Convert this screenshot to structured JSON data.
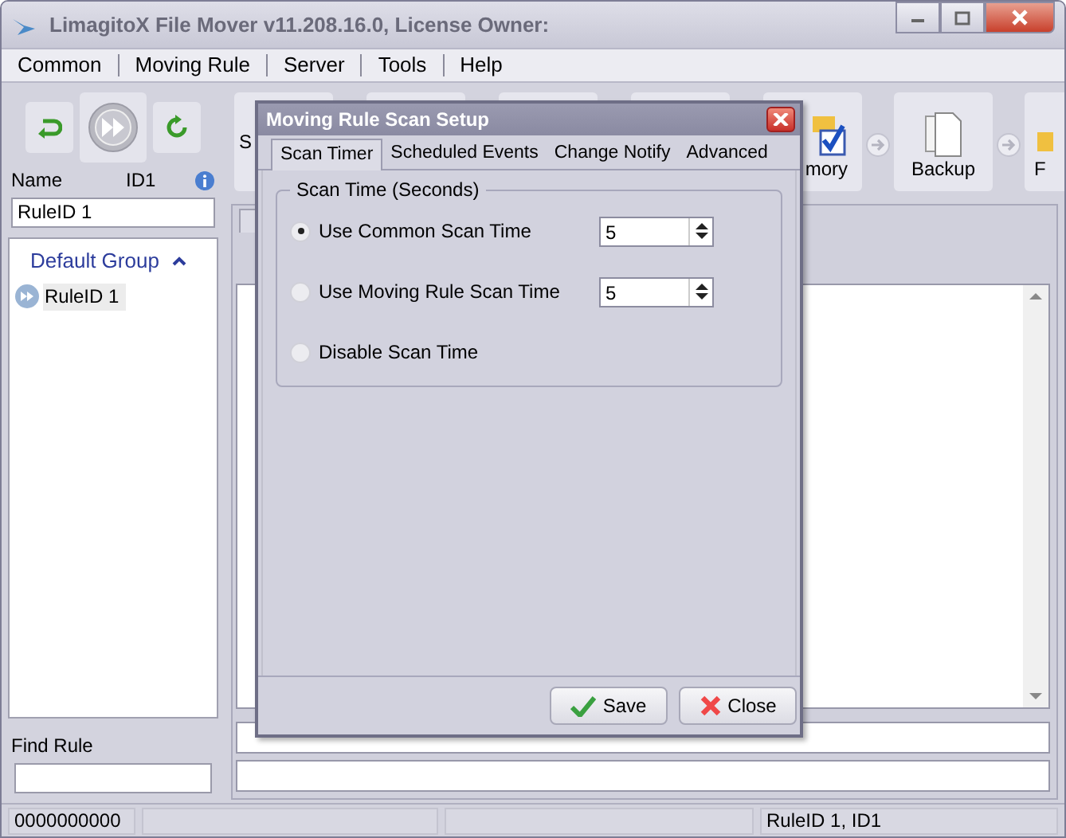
{
  "window": {
    "title": "LimagitoX File Mover v11.208.16.0,  License Owner:"
  },
  "menu": [
    {
      "label": "Common"
    },
    {
      "label": "Moving Rule"
    },
    {
      "label": "Server"
    },
    {
      "label": "Tools"
    },
    {
      "label": "Help"
    }
  ],
  "left_panel": {
    "name_label": "Name",
    "id_label": "ID1",
    "name_value": "RuleID 1",
    "find_label": "Find Rule",
    "group": {
      "label": "Default Group",
      "expanded": true,
      "children": [
        {
          "label": "RuleID 1",
          "selected": true
        }
      ]
    }
  },
  "toolbar": [
    {
      "kind": "plain",
      "label": "S"
    },
    {
      "kind": "plain"
    },
    {
      "kind": "plain"
    },
    {
      "kind": "plain"
    },
    {
      "kind": "checklist",
      "label": "mory"
    },
    {
      "kind": "pages",
      "label": "Backup"
    },
    {
      "kind": "folder",
      "label": "F"
    }
  ],
  "dialog": {
    "title": "Moving Rule Scan Setup",
    "tabs": [
      {
        "label": "Scan Timer",
        "selected": true
      },
      {
        "label": "Scheduled Events",
        "selected": false
      },
      {
        "label": "Change Notify",
        "selected": false
      },
      {
        "label": "Advanced",
        "selected": false
      }
    ],
    "group_title": "Scan Time  (Seconds)",
    "options": [
      {
        "label": "Use Common Scan Time",
        "selected": true,
        "value": "5"
      },
      {
        "label": "Use Moving Rule Scan Time",
        "selected": false,
        "value": "5"
      },
      {
        "label": "Disable Scan Time",
        "selected": false
      }
    ],
    "buttons": [
      {
        "kind": "save",
        "label": "Save"
      },
      {
        "kind": "close",
        "label": "Close"
      }
    ]
  },
  "status_bar": [
    "0000000000",
    "RuleID 1, ID1"
  ]
}
